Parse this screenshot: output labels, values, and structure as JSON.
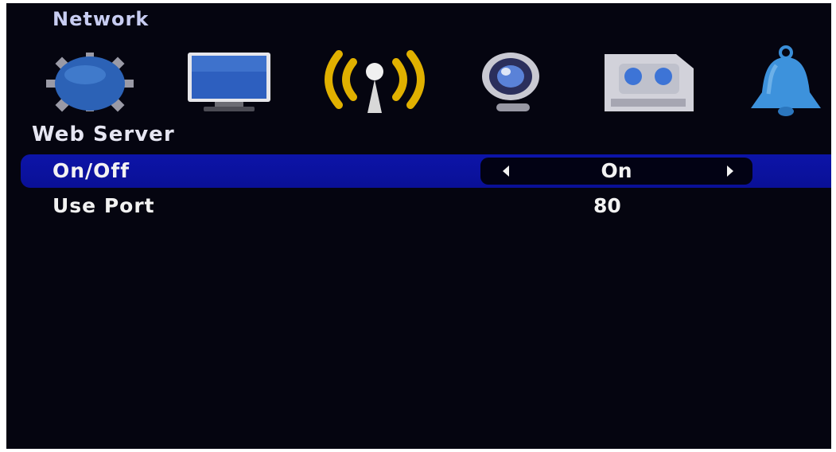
{
  "menu": {
    "title": "Network",
    "icons": [
      {
        "name": "gear-icon"
      },
      {
        "name": "monitor-icon"
      },
      {
        "name": "wireless-network-icon",
        "selected": true
      },
      {
        "name": "webcam-icon"
      },
      {
        "name": "recorder-icon"
      },
      {
        "name": "bell-icon"
      }
    ]
  },
  "section": {
    "title": "Web Server",
    "rows": [
      {
        "label": "On/Off",
        "value": "On",
        "selected": true
      },
      {
        "label": "Use Port",
        "value": "80",
        "selected": false
      }
    ]
  },
  "colors": {
    "background": "#050510",
    "highlight": "#0c14a8",
    "title": "#c8cdf2",
    "selected_icon": "#e0b000"
  }
}
